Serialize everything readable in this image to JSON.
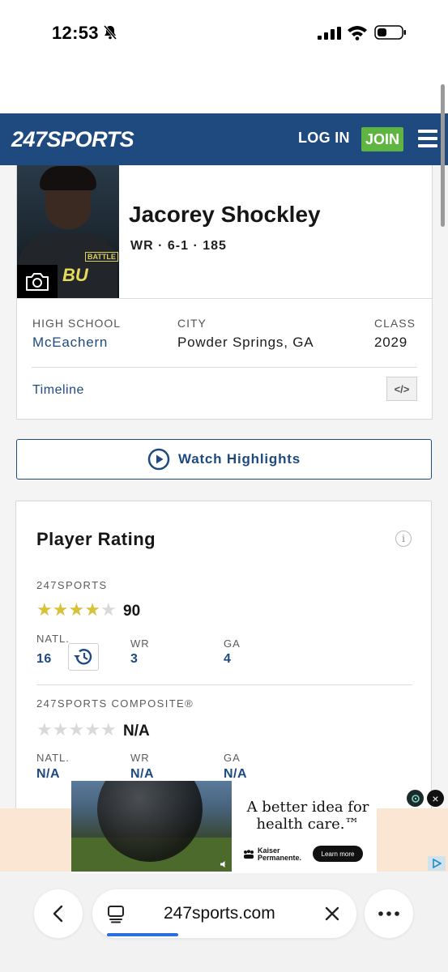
{
  "status_bar": {
    "time": "12:53"
  },
  "header": {
    "logo": "247SPORTS",
    "login_label": "LOG IN",
    "join_label": "JOIN",
    "colors": {
      "brand_blue": "#1e4a80",
      "join_green": "#5fb541"
    }
  },
  "profile": {
    "photo_text_small": "BATTLE",
    "photo_text_large": "BU",
    "name": "Jacorey Shockley",
    "meta": "WR · 6-1 · 185",
    "high_school_label": "HIGH SCHOOL",
    "high_school": "McEachern",
    "city_label": "CITY",
    "city": "Powder Springs, GA",
    "class_label": "CLASS",
    "class": "2029",
    "timeline_label": "Timeline",
    "embed_icon_text": "</>"
  },
  "highlights": {
    "label": "Watch Highlights"
  },
  "rating": {
    "title": "Player Rating",
    "info_icon_text": "i",
    "sports247": {
      "label": "247SPORTS",
      "stars_filled": 4,
      "stars_total": 5,
      "score": "90",
      "natl_label": "NATL.",
      "natl": "16",
      "pos_label": "WR",
      "pos": "3",
      "state_label": "GA",
      "state": "4"
    },
    "composite": {
      "label": "247SPORTS COMPOSITE®",
      "stars_filled": 0,
      "stars_total": 5,
      "score": "N/A",
      "natl_label": "NATL.",
      "natl": "N/A",
      "pos_label": "WR",
      "pos": "N/A",
      "state_label": "GA",
      "state": "N/A"
    }
  },
  "ad": {
    "headline": "A better idea for health care.™",
    "brand": "Kaiser Permanente.",
    "cta": "Learn more",
    "close": "×"
  },
  "browser": {
    "url": "247sports.com",
    "page_load_progress": 0.27
  }
}
